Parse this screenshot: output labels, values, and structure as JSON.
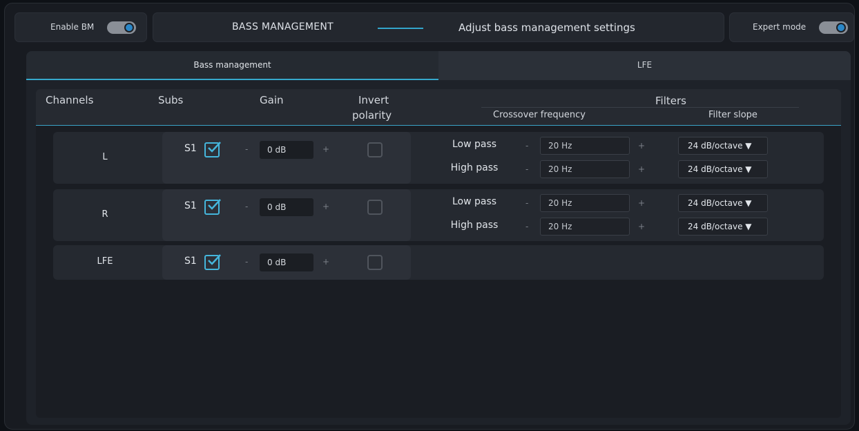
{
  "header": {
    "enable_bm_label": "Enable BM",
    "title": "BASS MANAGEMENT",
    "subtitle": "Adjust bass management settings",
    "expert_mode_label": "Expert mode"
  },
  "tabs": [
    {
      "label": "Bass management",
      "active": true
    },
    {
      "label": "LFE",
      "active": false
    }
  ],
  "columns": {
    "channels": "Channels",
    "subs": "Subs",
    "gain": "Gain",
    "invert_line1": "Invert",
    "invert_line2": "polarity",
    "filters": "Filters",
    "crossover": "Crossover frequency",
    "filter_slope": "Filter slope"
  },
  "rows": [
    {
      "channel": "L",
      "sub": "S1",
      "gain": "0 dB",
      "low_pass_label": "Low pass",
      "low_pass_freq": "20 Hz",
      "low_pass_slope": "24 dB/octave ▼",
      "high_pass_label": "High pass",
      "high_pass_freq": "20 Hz",
      "high_pass_slope": "24 dB/octave ▼"
    },
    {
      "channel": "R",
      "sub": "S1",
      "gain": "0 dB",
      "low_pass_label": "Low pass",
      "low_pass_freq": "20 Hz",
      "low_pass_slope": "24 dB/octave ▼",
      "high_pass_label": "High pass",
      "high_pass_freq": "20 Hz",
      "high_pass_slope": "24 dB/octave ▼"
    },
    {
      "channel": "LFE",
      "sub": "S1",
      "gain": "0 dB"
    }
  ],
  "controls": {
    "minus": "-",
    "plus": "+"
  },
  "colors": {
    "accent": "#36a9cc",
    "checkbox": "#45b6dc",
    "background": "#181b21"
  }
}
